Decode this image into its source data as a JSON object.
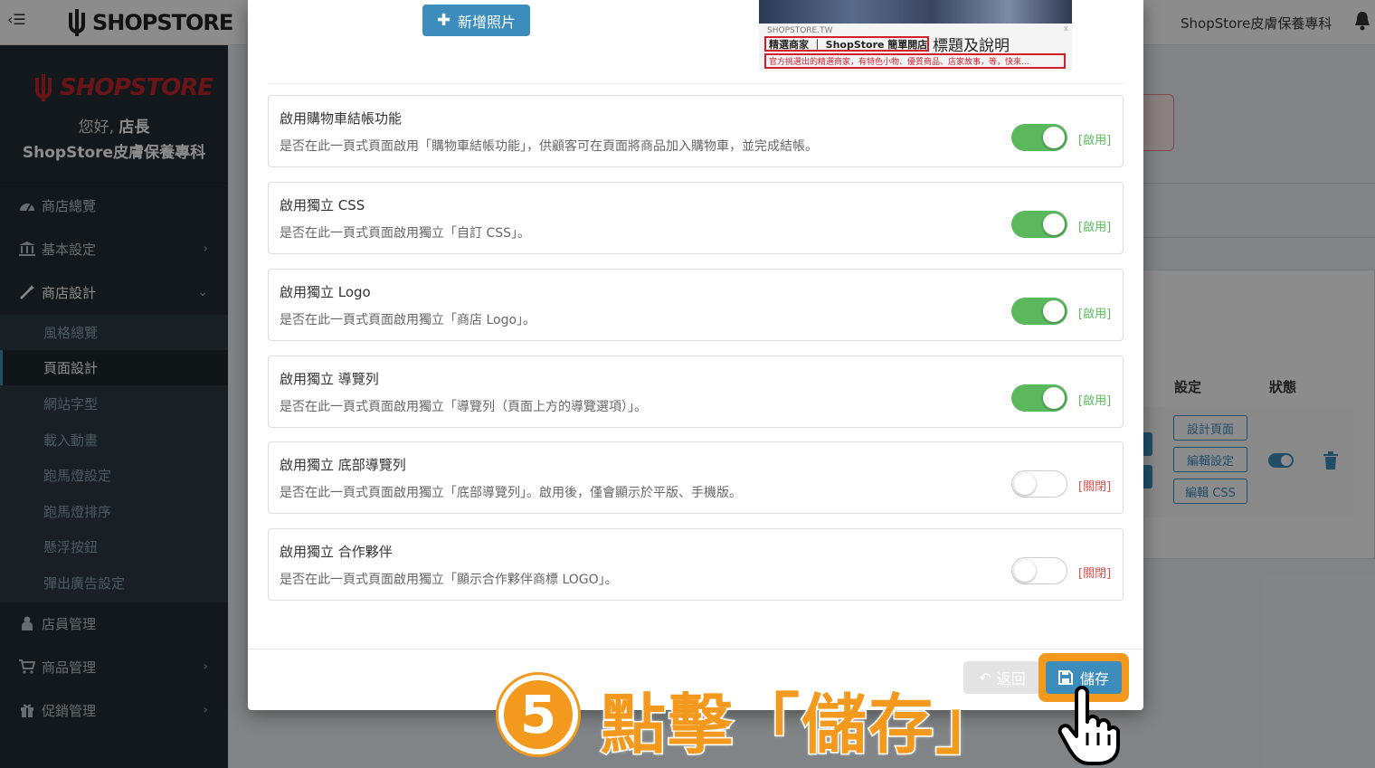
{
  "topbar": {
    "menu_icon": "menu-collapse-icon",
    "brand": "SHOPSTORE",
    "store_name": "ShopStore皮膚保養專科",
    "notification_icon": "bell-icon"
  },
  "sidebar": {
    "logo": "SHOPSTORE",
    "greeting_prefix": "您好, ",
    "greeting_role": "店長",
    "store_name": "ShopStore皮膚保養專科",
    "items": [
      {
        "label": "商店總覽",
        "icon": "dashboard-icon"
      },
      {
        "label": "基本設定",
        "icon": "bank-icon"
      },
      {
        "label": "商店設計",
        "icon": "magic-wand-icon"
      }
    ],
    "sub_items": [
      {
        "label": "風格總覽"
      },
      {
        "label": "頁面設計"
      },
      {
        "label": "網站字型"
      },
      {
        "label": "載入動畫"
      },
      {
        "label": "跑馬燈設定"
      },
      {
        "label": "跑馬燈排序"
      },
      {
        "label": "懸浮按鈕"
      },
      {
        "label": "彈出廣告設定"
      }
    ],
    "bottom_items": [
      {
        "label": "店員管理",
        "icon": "users-icon"
      },
      {
        "label": "商品管理",
        "icon": "cart-icon"
      },
      {
        "label": "促銷管理",
        "icon": "gift-icon"
      }
    ]
  },
  "background": {
    "col_settings": "設定",
    "col_status": "狀態",
    "btn_design": "設計頁面",
    "btn_edit_settings": "編輯設定",
    "btn_edit_css": "編輯 CSS"
  },
  "modal": {
    "add_photo": "新增照片",
    "preview": {
      "site": "SHOPSTORE.TW",
      "close": "x",
      "title": "精選商家 ｜ ShopStore 簡單開店",
      "annotation": "標題及說明",
      "desc": "官方挑選出的精選商家，有特色小物、優質商品、店家故事，等，快來..."
    },
    "options": [
      {
        "title": "啟用購物車結帳功能",
        "desc": "是否在此一頁式頁面啟用「購物車結帳功能」，供顧客可在頁面將商品加入購物車，並完成結帳。",
        "enabled": true,
        "status": "[啟用]"
      },
      {
        "title": "啟用獨立 CSS",
        "desc": "是否在此一頁式頁面啟用獨立「自訂 CSS」。",
        "enabled": true,
        "status": "[啟用]"
      },
      {
        "title": "啟用獨立 Logo",
        "desc": "是否在此一頁式頁面啟用獨立「商店 Logo」。",
        "enabled": true,
        "status": "[啟用]"
      },
      {
        "title": "啟用獨立 導覽列",
        "desc": "是否在此一頁式頁面啟用獨立「導覽列（頁面上方的導覽選項）」。",
        "enabled": true,
        "status": "[啟用]"
      },
      {
        "title": "啟用獨立 底部導覽列",
        "desc": "是否在此一頁式頁面啟用獨立「底部導覽列」。啟用後，僅會顯示於平版、手機版。",
        "enabled": false,
        "status": "[關閉]"
      },
      {
        "title": "啟用獨立 合作夥伴",
        "desc": "是否在此一頁式頁面啟用獨立「顯示合作夥伴商標 LOGO」。",
        "enabled": false,
        "status": "[關閉]"
      }
    ],
    "back_label": "返回",
    "save_label": "儲存"
  },
  "instruction": {
    "step": "5",
    "text": "點擊「儲存」"
  },
  "colors": {
    "accent": "#3c8dbc",
    "enabled": "#5cb85c",
    "disabled": "#d9534f",
    "highlight": "#f39a1e"
  }
}
